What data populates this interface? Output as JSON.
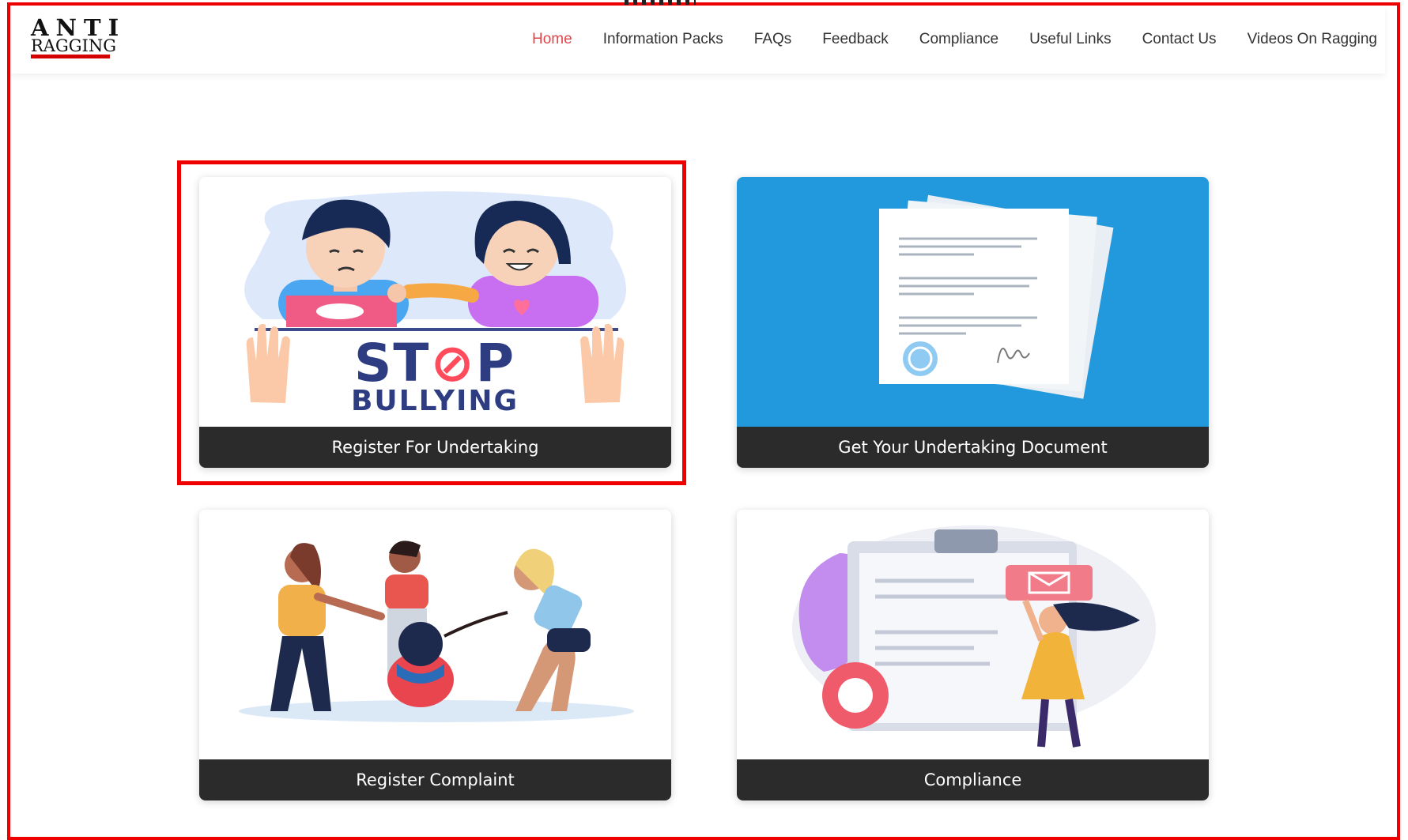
{
  "logo": {
    "line1": "ANTI",
    "line2": "RAGGING"
  },
  "nav": {
    "items": [
      {
        "label": "Home",
        "active": true
      },
      {
        "label": "Information Packs"
      },
      {
        "label": "FAQs"
      },
      {
        "label": "Feedback"
      },
      {
        "label": "Compliance"
      },
      {
        "label": "Useful Links"
      },
      {
        "label": "Contact Us"
      },
      {
        "label": "Videos On Ragging"
      }
    ]
  },
  "cards": [
    {
      "caption": "Register For Undertaking",
      "art_line1": "ST",
      "art_o": "⊘",
      "art_line1b": "P",
      "art_line2": "BULLYING"
    },
    {
      "caption": "Get Your Undertaking Document"
    },
    {
      "caption": "Register Complaint"
    },
    {
      "caption": "Compliance"
    }
  ],
  "colors": {
    "accent_active": "#e0454a",
    "caption_bg": "#2b2b2b",
    "doc_card_bg": "#2299dd",
    "highlight": "#ee0000"
  }
}
